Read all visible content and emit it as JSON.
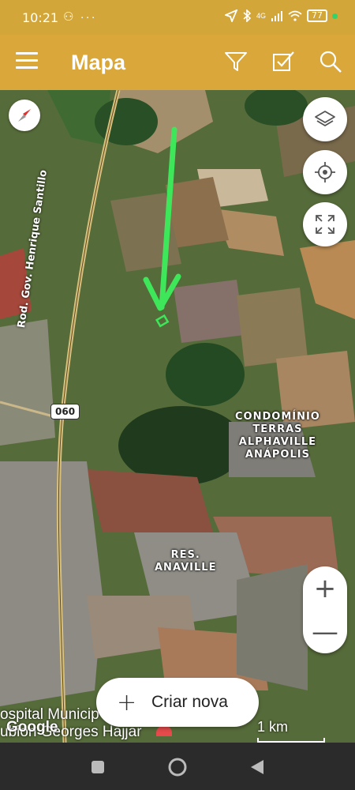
{
  "status_bar": {
    "time": "10:21",
    "left_icons": "⚇ ···",
    "network": "4G",
    "battery": "77"
  },
  "app_bar": {
    "title": "Mapa",
    "icons": [
      "menu-icon",
      "filter-icon",
      "checklist-icon",
      "search-icon"
    ]
  },
  "map": {
    "road_label": "Rod. Gov. Henrique Santillo",
    "road_shield": "060",
    "places": [
      {
        "line1": "CONDOMÍNIO",
        "line2": "TERRAS",
        "line3": "ALPHAVILLE",
        "line4": "ANÁPOLIS"
      },
      {
        "line1": "RES.",
        "line2": "ANAVILLE"
      }
    ],
    "bottom_place_line1": "ospital Municip",
    "bottom_place_line2": "ubion Georges Hajjar",
    "attribution": "Google",
    "scale": "1 km",
    "controls": [
      "compass-icon",
      "layers-icon",
      "my-location-icon",
      "fullscreen-icon"
    ],
    "zoom_in": "+",
    "zoom_out": "—",
    "create_button": "Criar nova",
    "create_plus": "+",
    "colors": {
      "arrow": "#3ee65a",
      "accent": "#d9a73a"
    }
  },
  "nav_bar": {
    "buttons": [
      "recents-icon",
      "home-icon",
      "back-icon"
    ]
  }
}
